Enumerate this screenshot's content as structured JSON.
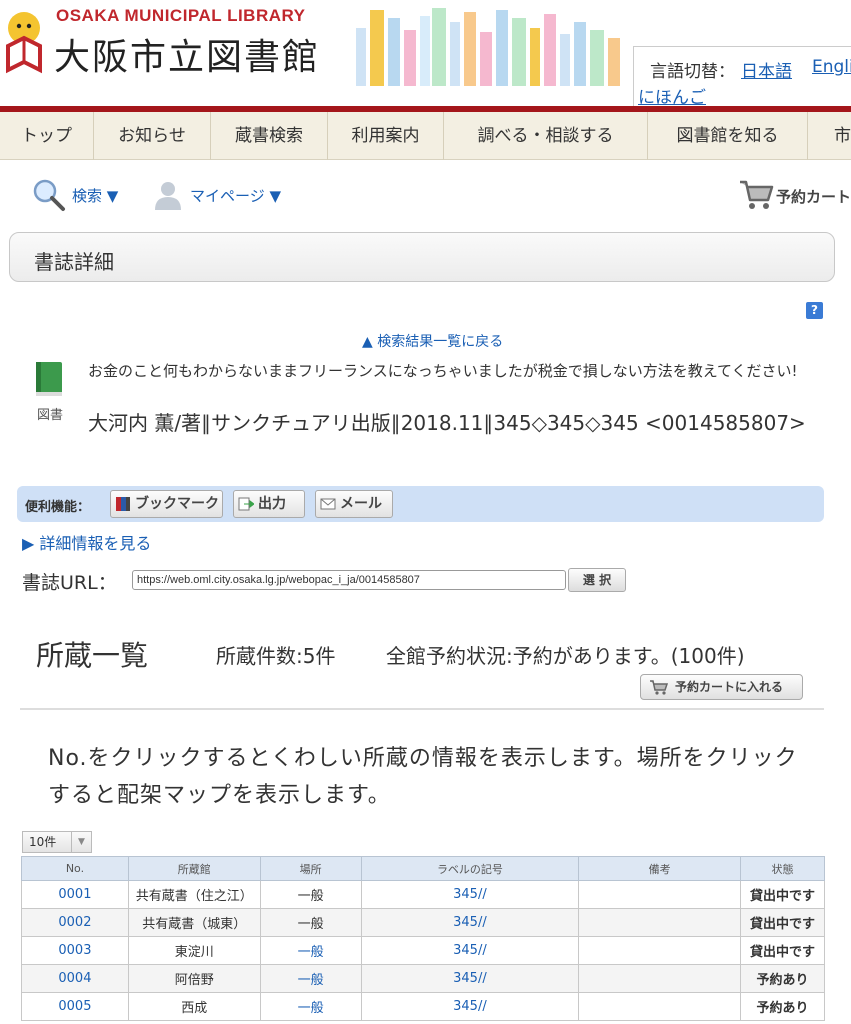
{
  "header": {
    "logo_en": "OSAKA MUNICIPAL LIBRARY",
    "logo_ja": "大阪市立図書館",
    "lang_label": "言語切替：",
    "lang_ja": "日本語",
    "lang_en": "English",
    "lang_nihongo": "にほんご"
  },
  "nav": {
    "items": [
      "トップ",
      "お知らせ",
      "蔵書検索",
      "利用案内",
      "調べる・相談する",
      "図書館を知る",
      "市"
    ]
  },
  "tools": {
    "search": "検索 ▼",
    "mypage": "マイページ ▼",
    "cart": "予約カート"
  },
  "page": {
    "title": "書誌詳細",
    "help": "?",
    "back_link": "▲ 検索結果一覧に戻る"
  },
  "record": {
    "icon_label": "図書",
    "title": "お金のこと何もわからないままフリーランスになっちゃいましたが税金で損しない方法を教えてください!",
    "meta": "大河内 薫/著∥サンクチュアリ出版∥2018.11∥345◇345◇345 <0014585807>"
  },
  "utilities": {
    "label": "便利機能：",
    "bookmark": "ブックマーク",
    "output": "出力",
    "mail": "メール"
  },
  "detail_link": "▶ 詳細情報を見る",
  "url": {
    "label": "書誌URL：",
    "value": "https://web.oml.city.osaka.lg.jp/webopac_i_ja/0014585807",
    "button": "選 択"
  },
  "holdings": {
    "title": "所蔵一覧",
    "count": "所蔵件数:5件",
    "status": "全館予約状況:予約があります。(100件)",
    "cart_button": "予約カートに入れる",
    "info": "No.をクリックするとくわしい所蔵の情報を表示します。場所をクリックすると配架マップを表示します。",
    "per_page": "10件",
    "columns": [
      "No.",
      "所蔵館",
      "場所",
      "ラベルの記号",
      "備考",
      "状態"
    ],
    "rows": [
      {
        "no": "0001",
        "branch": "共有蔵書（住之江）",
        "location": "一般",
        "location_link": false,
        "label": "345//",
        "note": "",
        "status": "貸出中です"
      },
      {
        "no": "0002",
        "branch": "共有蔵書（城東）",
        "location": "一般",
        "location_link": false,
        "label": "345//",
        "note": "",
        "status": "貸出中です"
      },
      {
        "no": "0003",
        "branch": "東淀川",
        "location": "一般",
        "location_link": true,
        "label": "345//",
        "note": "",
        "status": "貸出中です"
      },
      {
        "no": "0004",
        "branch": "阿倍野",
        "location": "一般",
        "location_link": true,
        "label": "345//",
        "note": "",
        "status": "予約あり"
      },
      {
        "no": "0005",
        "branch": "西成",
        "location": "一般",
        "location_link": true,
        "label": "345//",
        "note": "",
        "status": "予約あり"
      }
    ]
  },
  "colors": {
    "brand_red": "#c0272d",
    "link_blue": "#1a5fb4",
    "nav_bg": "#f3efe2",
    "util_bar": "#cfe0f6",
    "table_header": "#dde7f3"
  }
}
